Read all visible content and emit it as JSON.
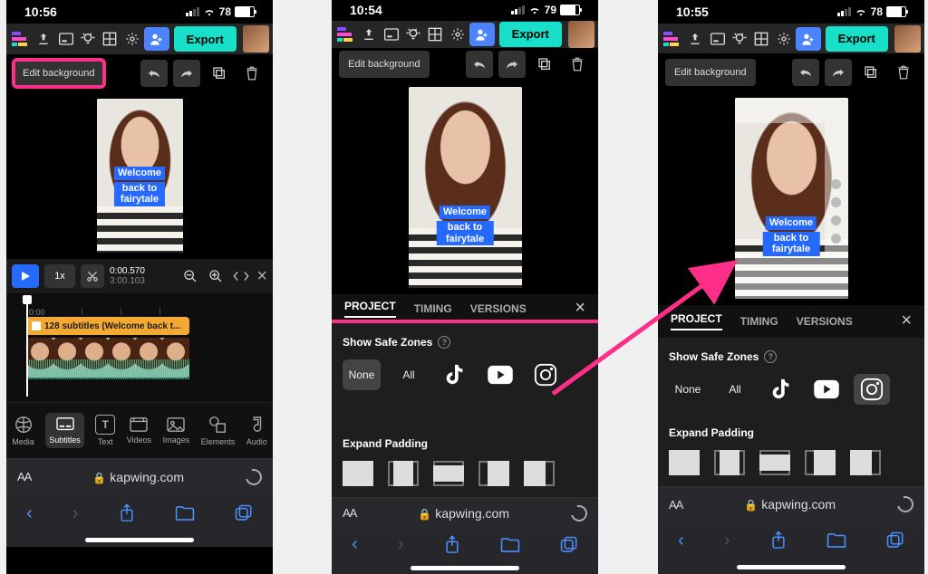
{
  "status": {
    "time1": "10:56",
    "time2": "10:54",
    "time3": "10:55",
    "battery1": "78",
    "battery2": "79",
    "battery3": "78"
  },
  "toolbar": {
    "export_label": "Export"
  },
  "edit_bg_label": "Edit background",
  "subtitle_line1": "Welcome",
  "subtitle_line2": "back to fairytale",
  "timeline": {
    "play_speed": "1x",
    "current_time": "0:00.570",
    "total_time": "3:00.103",
    "ruler_marks": [
      "0:00"
    ],
    "track_label": "128 subtitles (Welcome back t..."
  },
  "bottom_tabs": [
    "Media",
    "Subtitles",
    "Text",
    "Videos",
    "Images",
    "Elements",
    "Audio"
  ],
  "bottom_tabs_active_index": 1,
  "panel": {
    "tabs": [
      "PROJECT",
      "TIMING",
      "VERSIONS"
    ],
    "active_tab_index": 0,
    "safe_zones_label": "Show Safe Zones",
    "safe_zone_options": [
      "None",
      "All"
    ],
    "safe_zone_selected_p2": "None",
    "safe_zone_selected_p3": "instagram",
    "expand_padding_label": "Expand Padding"
  },
  "url": "kapwing.com"
}
